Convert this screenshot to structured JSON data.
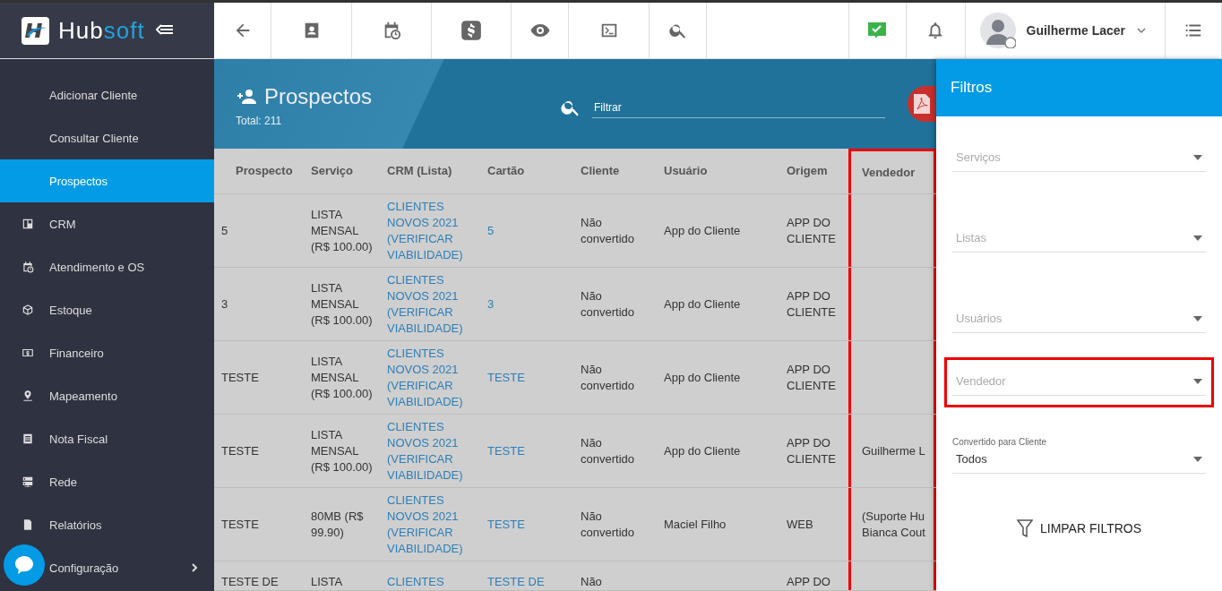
{
  "logo": {
    "part_1": "Hub",
    "part_2": "soft"
  },
  "user": {
    "name": "Guilherme Lacer"
  },
  "sidebar": {
    "items": [
      {
        "label": "Adicionar Cliente",
        "kind": "sub",
        "selected": false
      },
      {
        "label": "Consultar Cliente",
        "kind": "sub",
        "selected": false
      },
      {
        "label": "Prospectos",
        "kind": "sub",
        "selected": true
      },
      {
        "label": "CRM",
        "kind": "board",
        "selected": false
      },
      {
        "label": "Atendimento e OS",
        "kind": "calendar",
        "selected": false
      },
      {
        "label": "Estoque",
        "kind": "box",
        "selected": false
      },
      {
        "label": "Financeiro",
        "kind": "money",
        "selected": false
      },
      {
        "label": "Mapeamento",
        "kind": "pin",
        "selected": false
      },
      {
        "label": "Nota Fiscal",
        "kind": "doc",
        "selected": false
      },
      {
        "label": "Rede",
        "kind": "server",
        "selected": false
      },
      {
        "label": "Relatórios",
        "kind": "report",
        "selected": false
      },
      {
        "label": "Configuração",
        "kind": "gear",
        "selected": false,
        "expandable": true
      }
    ]
  },
  "page": {
    "title": "Prospectos",
    "total": "Total: 211",
    "search": {
      "placeholder": "Filtrar"
    }
  },
  "table": {
    "columns": [
      {
        "label": "Prospecto",
        "highlighted": false
      },
      {
        "label": "Serviço",
        "highlighted": false
      },
      {
        "label": "CRM (Lista)",
        "highlighted": false
      },
      {
        "label": "Cartão",
        "highlighted": false
      },
      {
        "label": "Cliente",
        "highlighted": false
      },
      {
        "label": "Usuário",
        "highlighted": false
      },
      {
        "label": "Origem",
        "highlighted": false
      },
      {
        "label": "Vendedor",
        "highlighted": true
      }
    ],
    "rows": [
      {
        "prospecto": "5",
        "servico": "LISTA MENSAL (R$ 100.00)",
        "crm": "CLIENTES NOVOS 2021 (VERIFICAR VIABILIDADE)",
        "cartao": "5",
        "cliente": "Não convertido",
        "usuario": "App do Cliente",
        "origem": "APP DO CLIENTE"
      },
      {
        "prospecto": "3",
        "servico": "LISTA MENSAL (R$ 100.00)",
        "crm": "CLIENTES NOVOS 2021 (VERIFICAR VIABILIDADE)",
        "cartao": "3",
        "cliente": "Não convertido",
        "usuario": "App do Cliente",
        "origem": "APP DO CLIENTE"
      },
      {
        "prospecto": "TESTE",
        "servico": "LISTA MENSAL (R$ 100.00)",
        "crm": "CLIENTES NOVOS 2021 (VERIFICAR VIABILIDADE)",
        "cartao": "TESTE",
        "cliente": "Não convertido",
        "usuario": "App do Cliente",
        "origem": "APP DO CLIENTE"
      },
      {
        "prospecto": "TESTE",
        "servico": "LISTA MENSAL (R$ 100.00)",
        "crm": "CLIENTES NOVOS 2021 (VERIFICAR VIABILIDADE)",
        "cartao": "TESTE",
        "cliente": "Não convertido",
        "usuario": "App do Cliente",
        "origem": "APP DO CLIENTE",
        "vendedor": "Guilherme L"
      },
      {
        "prospecto": "TESTE",
        "servico": "80MB (R$ 99.90)",
        "crm": "CLIENTES NOVOS 2021 (VERIFICAR VIABILIDADE)",
        "cartao": "TESTE",
        "cliente": "Não convertido",
        "usuario": "Maciel Filho",
        "origem": "WEB",
        "vendedor": "(Suporte Hu\nBianca Cout"
      },
      {
        "prospecto": "TESTE DE",
        "servico": "LISTA",
        "crm": "CLIENTES",
        "cartao": "TESTE DE",
        "cliente": "Não",
        "origem": "APP DO"
      }
    ]
  },
  "filters": {
    "title": "Filtros",
    "fields": [
      {
        "placeholder": "Serviços",
        "highlighted": false
      },
      {
        "placeholder": "Listas",
        "highlighted": false
      },
      {
        "placeholder": "Usuários",
        "highlighted": false
      },
      {
        "placeholder": "Vendedor",
        "highlighted": true
      },
      {
        "label": "Convertido para Cliente",
        "value": "Todos",
        "highlighted": false
      }
    ],
    "clear_button": "LIMPAR FILTROS"
  }
}
